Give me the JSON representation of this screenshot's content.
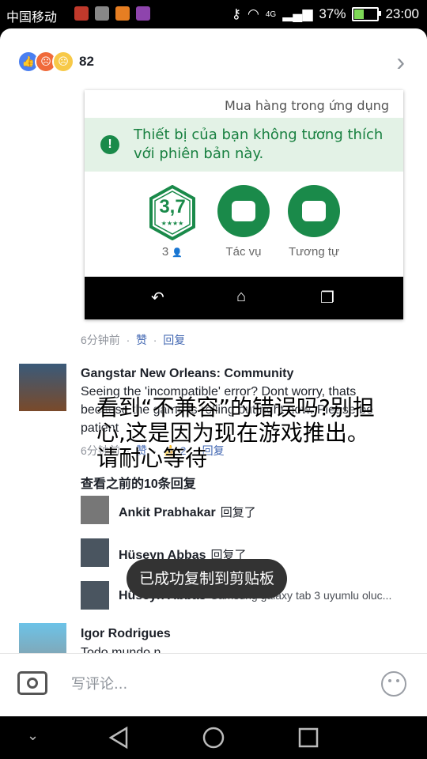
{
  "status": {
    "carrier": "中国移动",
    "network": "4G",
    "battery": "37%",
    "battery_level": 0.37,
    "time": "23:00"
  },
  "reactions": {
    "count": "82",
    "icons": [
      "like-icon",
      "angry-icon",
      "sad-icon"
    ]
  },
  "embedded_screenshot": {
    "in_app_purchase": "Mua hàng trong ứng dụng",
    "warning": "Thiết bị của bạn không tương thích với phiên bản này.",
    "rating": "3,7",
    "rating_count": "3",
    "tasks_label": "Tác vụ",
    "similar_label": "Tương tự"
  },
  "first_comment_meta": {
    "time": "6分钟前",
    "like": "赞",
    "reply": "回复"
  },
  "main_comment": {
    "author": "Gangstar New Orleans: Community",
    "text": "Seeing the 'incompatible' error? Dont worry, thats because the game is rolling out right now. Please be patient",
    "time": "6分钟前",
    "like": "赞",
    "reply_count": "2",
    "reply": "回复"
  },
  "view_previous": "查看之前的10条回复",
  "replies": [
    {
      "author": "Ankit Prabhakar",
      "action": "回复了",
      "text": ""
    },
    {
      "author": "Hüseyn Abbas",
      "action": "回复了",
      "text": ""
    },
    {
      "author": "Hüseyn Abbas",
      "action": "",
      "text": "Samsung galaxy tab 3 uyumlu oluc..."
    }
  ],
  "last_comment": {
    "author": "Igor Rodrigues",
    "text": "Todo mundo n"
  },
  "translation_overlay": "看到“不兼容”的错误吗?别担心,这是因为现在游戏推出。请耐心等待",
  "toast": "已成功复制到剪贴板",
  "composer": {
    "placeholder": "写评论..."
  },
  "colors": {
    "facebook_blue": "#4267b2",
    "play_green": "#1a8a4a",
    "warning_bg": "#e3f2e6"
  }
}
